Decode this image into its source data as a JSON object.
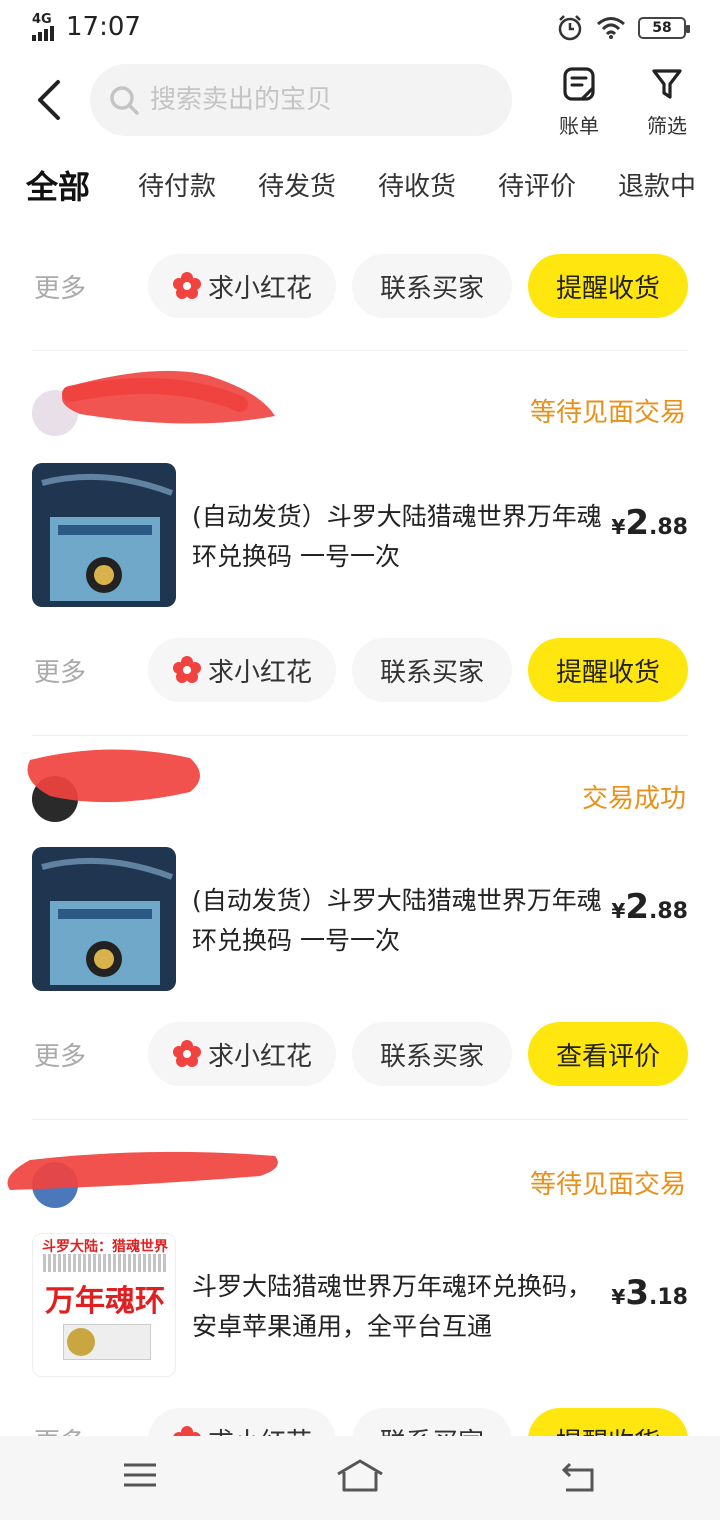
{
  "status_bar": {
    "network": "4G",
    "time": "17:07",
    "battery": "58"
  },
  "header": {
    "search_placeholder": "搜索卖出的宝贝",
    "bill_label": "账单",
    "filter_label": "筛选"
  },
  "tabs": [
    {
      "label": "全部",
      "active": true
    },
    {
      "label": "待付款"
    },
    {
      "label": "待发货"
    },
    {
      "label": "待收货"
    },
    {
      "label": "待评价"
    },
    {
      "label": "退款中"
    }
  ],
  "common": {
    "more_label": "更多",
    "flower_label": "求小红花",
    "contact_label": "联系买家"
  },
  "orders": [
    {
      "primary_action": "提醒收货"
    },
    {
      "status": "等待见面交易",
      "item_title": "(自动发货）斗罗大陆猎魂世界万年魂环兑换码 一号一次",
      "price_currency": "¥",
      "price_int": "2",
      "price_dec": ".88",
      "primary_action": "提醒收货"
    },
    {
      "status": "交易成功",
      "item_title": "(自动发货）斗罗大陆猎魂世界万年魂环兑换码 一号一次",
      "price_currency": "¥",
      "price_int": "2",
      "price_dec": ".88",
      "primary_action": "查看评价"
    },
    {
      "status": "等待见面交易",
      "item_title": "斗罗大陆猎魂世界万年魂环兑换码，安卓苹果通用，全平台互通",
      "price_currency": "¥",
      "price_int": "3",
      "price_dec": ".18",
      "thumb_text": {
        "top": "斗罗大陆：猎魂世界",
        "main": "万年魂环"
      },
      "primary_action": "提醒收货"
    }
  ],
  "colors": {
    "accent_yellow": "#ffe60f",
    "status_orange": "#e8901a",
    "scribble_red": "#f0433f"
  },
  "nav_icons": [
    "menu-icon",
    "home-icon",
    "back-icon"
  ]
}
